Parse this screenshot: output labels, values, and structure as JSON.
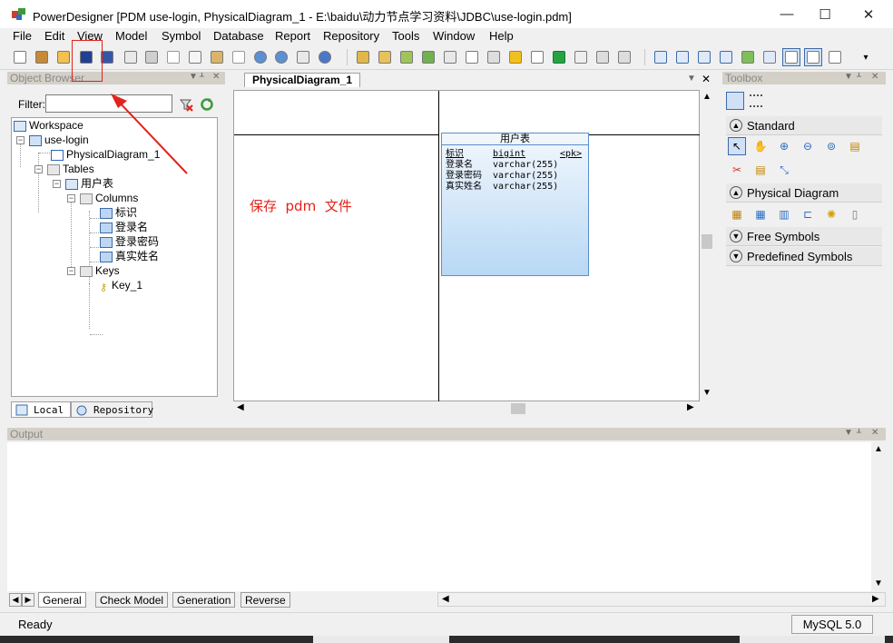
{
  "window": {
    "title": "PowerDesigner [PDM use-login, PhysicalDiagram_1 - E:\\baidu\\动力节点学习资料\\JDBC\\use-login.pdm]",
    "minimize_glyph": "—",
    "maximize_glyph": "☐",
    "close_glyph": "✕"
  },
  "menu": [
    "File",
    "Edit",
    "View",
    "Model",
    "Symbol",
    "Database",
    "Report",
    "Repository",
    "Tools",
    "Window",
    "Help"
  ],
  "object_browser": {
    "header": "Object Browser",
    "filter_label": "Filter:",
    "tree": {
      "workspace": "Workspace",
      "model": "use-login",
      "diagram": "PhysicalDiagram_1",
      "tables": "Tables",
      "table": "用户表",
      "columns": "Columns",
      "column_items": [
        "标识",
        "登录名",
        "登录密码",
        "真实姓名"
      ],
      "keys": "Keys",
      "key_items": [
        "Key_1"
      ]
    },
    "tabs": [
      "Local",
      "Repository"
    ]
  },
  "diagram": {
    "tab": "PhysicalDiagram_1",
    "entity": {
      "title": "用户表",
      "rows": [
        {
          "name": "标识",
          "type": "bigint",
          "key": "<pk>"
        },
        {
          "name": "登录名",
          "type": "varchar(255)",
          "key": ""
        },
        {
          "name": "登录密码",
          "type": "varchar(255)",
          "key": ""
        },
        {
          "name": "真实姓名",
          "type": "varchar(255)",
          "key": ""
        }
      ]
    },
    "annotation": "保存  pdm  文件"
  },
  "toolbox": {
    "header": "Toolbox",
    "sections": [
      "Standard",
      "Physical Diagram",
      "Free Symbols",
      "Predefined Symbols"
    ]
  },
  "output": {
    "header": "Output",
    "tabs": [
      "General",
      "Check Model",
      "Generation",
      "Reverse"
    ]
  },
  "status": {
    "text": "Ready",
    "dbms": "MySQL 5.0"
  },
  "colors": {
    "annotation_red": "#e2231a",
    "entity_border": "#5b8ecb",
    "panel_header": "#d4d0c8"
  }
}
